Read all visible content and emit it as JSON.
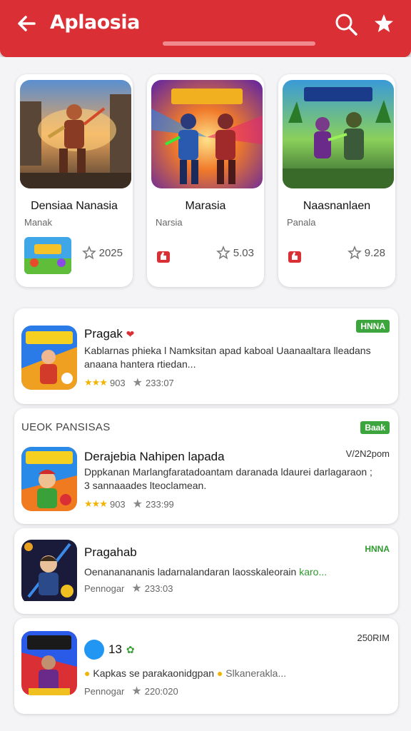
{
  "header": {
    "title": "Aplaosia"
  },
  "featured": [
    {
      "name": "Densiaa Nanasia",
      "subtitle": "Manak",
      "rating": "2025"
    },
    {
      "name": "Marasia",
      "subtitle": "Narsia",
      "rating": "5.03"
    },
    {
      "name": "Naasnanlaen",
      "subtitle": "Panala",
      "rating": "9.28"
    }
  ],
  "apps": [
    {
      "title": "Pragak",
      "badge": "HNNA",
      "desc": "Kablarnas phieka l Namksitan apad kaboal Uaanaaltara lleadans anaana hantera rtiedan...",
      "rating": "903",
      "count": "233:07"
    },
    {
      "section": "UEOK PANSISAS",
      "title": "Derajebia Nahipen lapada",
      "badge": "Baak",
      "date": "V/2N2pom",
      "desc": "Dppkanan Marlangfaratadoantam daranada ldaurei darlagaraon ; 3 sannaaades lteoclamean.",
      "rating": "903",
      "count": "233:99"
    },
    {
      "title": "Pragahab",
      "badge": "HNNA",
      "desc": "Oenananananis ladarnalandaran laosskaleorain",
      "desc_highlight": "karo...",
      "publisher": "Pennogar",
      "count": "233:03"
    },
    {
      "title": "13",
      "date": "250RIM",
      "desc": "Kapkas se parakaonidgpan",
      "desc_tail": "Slkanerakla...",
      "publisher": "Pennogar",
      "count": "220:020"
    }
  ]
}
